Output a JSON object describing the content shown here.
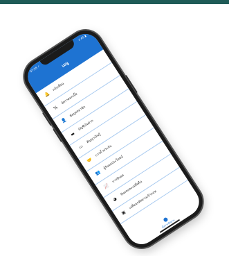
{
  "status": {
    "time": "07:58 ✓",
    "icons": "ıl 4G ▮"
  },
  "header": {
    "title": "เมนู"
  },
  "menu": [
    {
      "label": "แจ้งเตือน",
      "icon": "bell-icon",
      "glyph": "🔔"
    },
    {
      "label": "อัตราดอกเบี้ย",
      "icon": "percent-icon",
      "glyph": "%"
    },
    {
      "label": "ข้อมูลสมาชิก",
      "icon": "user-icon",
      "glyph": "👤"
    },
    {
      "label": "บัญชีเงินฝาก",
      "icon": "book-icon",
      "glyph": "▬"
    },
    {
      "label": "สัญญาเงินกู้",
      "icon": "card-icon",
      "glyph": "▭"
    },
    {
      "label": "การค้ำประกัน",
      "icon": "handshake-icon",
      "glyph": "🤝"
    },
    {
      "label": "ผู้รับผลประโยชน์",
      "icon": "people-icon",
      "glyph": "👥"
    },
    {
      "label": "การปันผล",
      "icon": "chart-icon",
      "glyph": "📈"
    },
    {
      "label": "ปันผลและเฉลี่ยคืน",
      "icon": "pie-icon",
      "glyph": "◕"
    },
    {
      "label": "เปลี่ยนรหัสผ่านเข้าแอพ",
      "icon": "lock-icon",
      "glyph": "▣"
    }
  ],
  "bottom_tab": {
    "label": "ตั้งค่ารหัสผ่าน"
  },
  "colors": {
    "accent": "#1e73d2",
    "divider": "#aacbf0",
    "frame": "#1b1b1b"
  }
}
